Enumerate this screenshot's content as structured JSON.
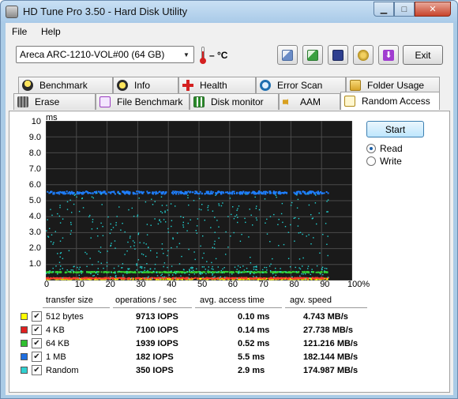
{
  "window": {
    "title": "HD Tune Pro 3.50 - Hard Disk Utility"
  },
  "menu": {
    "file": "File",
    "help": "Help"
  },
  "toolbar": {
    "drive": "Areca   ARC-1210-VOL#00 (64 GB)",
    "temperature": "– °C",
    "exit_label": "Exit"
  },
  "tabs_row1": [
    {
      "label": "Benchmark",
      "icon": "benchmark-icon"
    },
    {
      "label": "Info",
      "icon": "info-icon"
    },
    {
      "label": "Health",
      "icon": "health-icon"
    },
    {
      "label": "Error Scan",
      "icon": "error-scan-icon"
    },
    {
      "label": "Folder Usage",
      "icon": "folder-usage-icon"
    }
  ],
  "tabs_row2": [
    {
      "label": "Erase",
      "icon": "erase-icon"
    },
    {
      "label": "File Benchmark",
      "icon": "file-benchmark-icon"
    },
    {
      "label": "Disk monitor",
      "icon": "disk-monitor-icon"
    },
    {
      "label": "AAM",
      "icon": "aam-icon"
    },
    {
      "label": "Random Access",
      "icon": "random-access-icon",
      "active": true
    }
  ],
  "controls": {
    "start_label": "Start",
    "read_label": "Read",
    "write_label": "Write",
    "mode": "Read"
  },
  "chart_data": {
    "type": "scatter",
    "ylabel": "ms",
    "y_ticks": [
      "10",
      "9.0",
      "8.0",
      "7.0",
      "6.0",
      "5.0",
      "4.0",
      "3.0",
      "2.0",
      "1.0"
    ],
    "x_ticks": [
      "0",
      "10",
      "20",
      "30",
      "40",
      "50",
      "60",
      "70",
      "80",
      "90",
      "100%"
    ],
    "ylim": [
      0,
      10
    ],
    "xlim": [
      0,
      100
    ],
    "grid": true,
    "background": "#1a1a1a",
    "series": [
      {
        "name": "512 bytes",
        "color": "#ffff00",
        "typical_ms": 0.1
      },
      {
        "name": "4 KB",
        "color": "#ff3b30",
        "typical_ms": 0.14
      },
      {
        "name": "64 KB",
        "color": "#33cc33",
        "typical_ms": 0.52
      },
      {
        "name": "1 MB",
        "color": "#1f7fff",
        "typical_ms": 5.5
      },
      {
        "name": "Random",
        "color": "#22d6d6",
        "typical_ms": 2.9
      }
    ]
  },
  "results": {
    "headers": [
      "transfer size",
      "operations / sec",
      "avg. access time",
      "agv. speed"
    ],
    "rows": [
      {
        "size": "512 bytes",
        "color": "#ffff00",
        "checked": true,
        "iops": "9713 IOPS",
        "access": "0.10 ms",
        "speed": "4.743 MB/s"
      },
      {
        "size": "4 KB",
        "color": "#e02020",
        "checked": true,
        "iops": "7100 IOPS",
        "access": "0.14 ms",
        "speed": "27.738 MB/s"
      },
      {
        "size": "64 KB",
        "color": "#30c030",
        "checked": true,
        "iops": "1939 IOPS",
        "access": "0.52 ms",
        "speed": "121.216 MB/s"
      },
      {
        "size": "1 MB",
        "color": "#1f6fe0",
        "checked": true,
        "iops": "182 IOPS",
        "access": "5.5 ms",
        "speed": "182.144 MB/s"
      },
      {
        "size": "Random",
        "color": "#30d0d0",
        "checked": true,
        "iops": "350 IOPS",
        "access": "2.9 ms",
        "speed": "174.987 MB/s"
      }
    ]
  }
}
